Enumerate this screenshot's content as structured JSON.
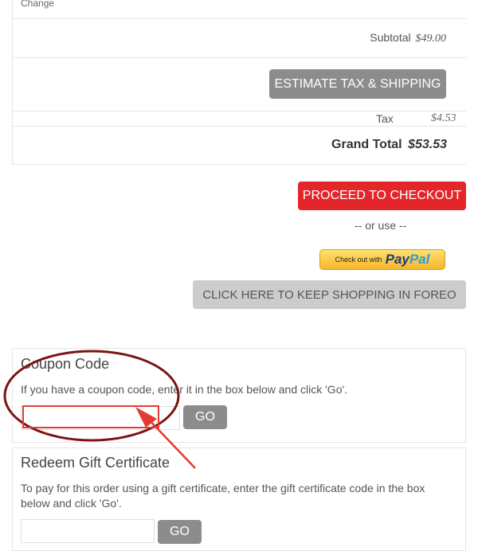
{
  "cart": {
    "change_link": "Change",
    "subtotal_label": "Subtotal",
    "subtotal_value": "$49.00",
    "estimate_button": "ESTIMATE TAX & SHIPPING",
    "tax_label": "Tax",
    "tax_value": "$4.53",
    "grand_total_label": "Grand Total",
    "grand_total_value": "$53.53"
  },
  "checkout": {
    "proceed_button": "PROCEED TO CHECKOUT",
    "or_use": "-- or use --",
    "paypal_small": "Check out with",
    "paypal_pay": "Pay",
    "paypal_pal": "Pal",
    "keep_shopping_button": "CLICK HERE TO KEEP SHOPPING IN FOREO"
  },
  "coupon": {
    "title": "Coupon Code",
    "description": "If you have a coupon code, enter it in the box below and click 'Go'.",
    "input_value": "",
    "go_button": "GO"
  },
  "gift": {
    "title": "Redeem Gift Certificate",
    "description": "To pay for this order using a gift certificate, enter the gift certificate code in the box below and click 'Go'.",
    "input_value": "",
    "go_button": "GO"
  },
  "annotation": {
    "ellipse_color": "#7a1414",
    "highlight_color": "#e53935",
    "arrow_color": "#e53935"
  },
  "colors": {
    "accent_red": "#e4262b",
    "button_gray": "#8c8c8c",
    "button_light": "#cccccc"
  }
}
